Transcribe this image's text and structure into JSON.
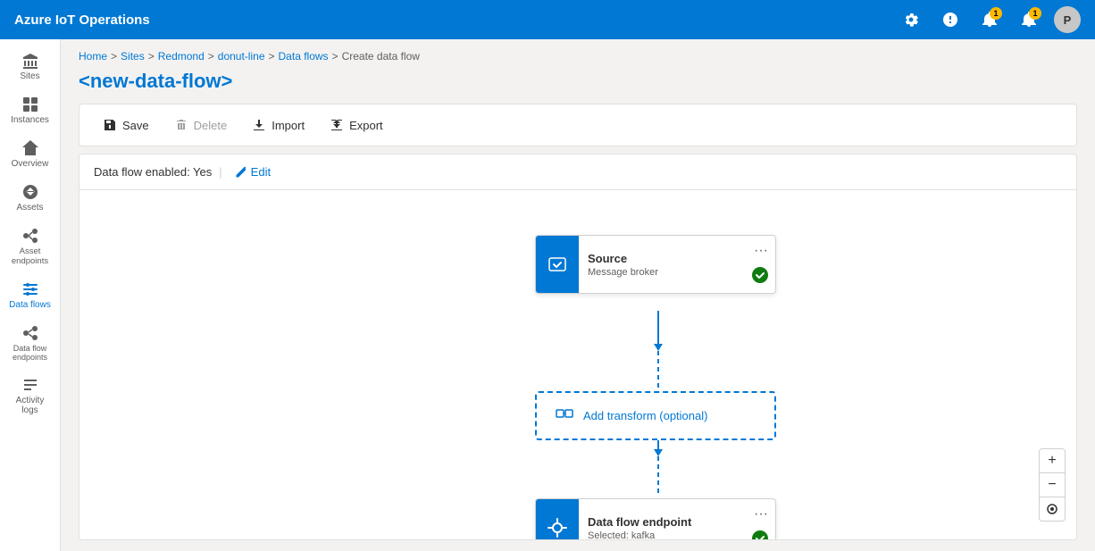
{
  "app": {
    "title": "Azure IoT Operations"
  },
  "header": {
    "title": "Azure IoT Operations",
    "settings_icon": "⚙",
    "help_icon": "?",
    "notification_icon": "🔔",
    "alert_icon": "🔔",
    "notification_badge": "1",
    "alert_badge": "1",
    "avatar_label": "P"
  },
  "breadcrumb": {
    "items": [
      "Home",
      "Sites",
      "Redmond",
      "donut-line",
      "Data flows",
      "Create data flow"
    ],
    "separator": ">"
  },
  "page": {
    "title": "<new-data-flow>"
  },
  "toolbar": {
    "save_label": "Save",
    "delete_label": "Delete",
    "import_label": "Import",
    "export_label": "Export"
  },
  "flow": {
    "status_label": "Data flow enabled: Yes",
    "edit_label": "Edit",
    "source_node": {
      "title": "Source",
      "subtitle": "Message broker",
      "more": "···"
    },
    "transform_node": {
      "label": "Add transform (optional)"
    },
    "destination_node": {
      "title": "Data flow endpoint",
      "subtitle": "Selected: kafka",
      "more": "···"
    }
  },
  "sidebar": {
    "items": [
      {
        "id": "sites",
        "label": "Sites"
      },
      {
        "id": "instances",
        "label": "Instances"
      },
      {
        "id": "overview",
        "label": "Overview"
      },
      {
        "id": "assets",
        "label": "Assets"
      },
      {
        "id": "asset-endpoints",
        "label": "Asset endpoints"
      },
      {
        "id": "data-flows",
        "label": "Data flows"
      },
      {
        "id": "data-flow-endpoints",
        "label": "Data flow endpoints"
      },
      {
        "id": "activity-logs",
        "label": "Activity logs"
      }
    ]
  },
  "zoom": {
    "plus_label": "+",
    "minus_label": "−",
    "reset_label": "⊙"
  }
}
